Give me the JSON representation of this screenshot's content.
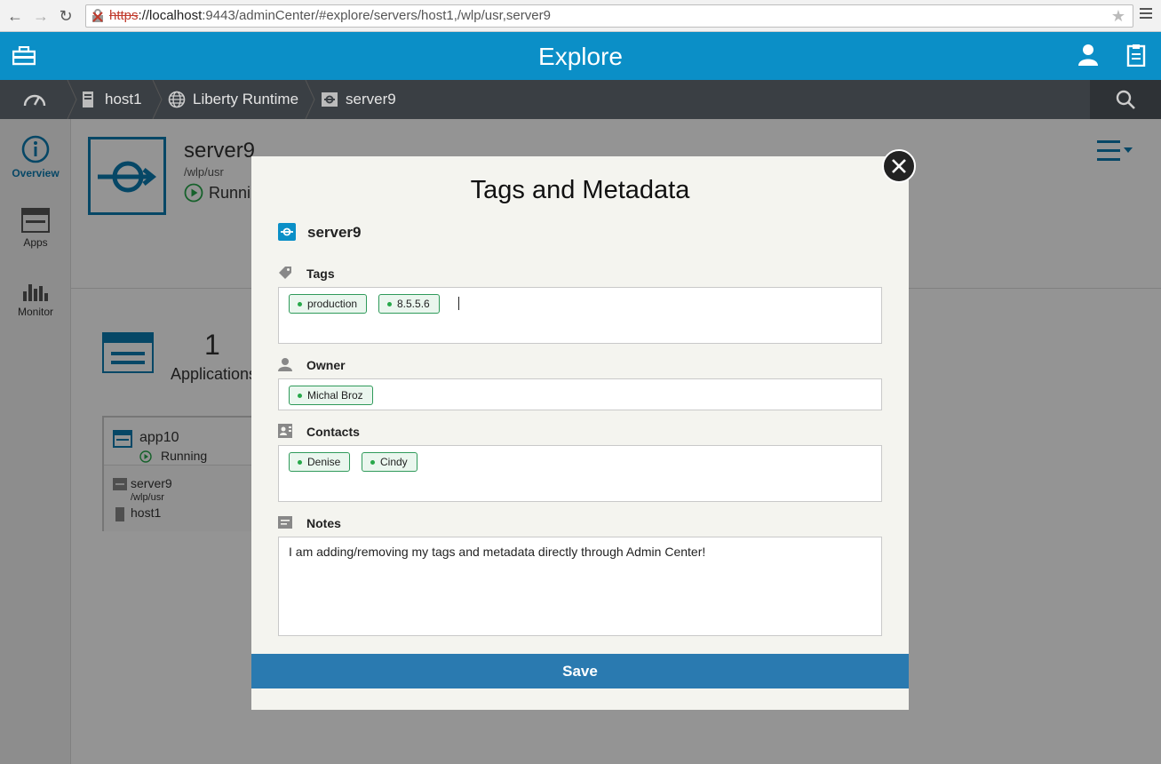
{
  "browser": {
    "url_scheme": "https",
    "url_host": "://localhost",
    "url_rest": ":9443/adminCenter/#explore/servers/host1,/wlp/usr,server9"
  },
  "header": {
    "title": "Explore"
  },
  "breadcrumb": {
    "items": [
      {
        "label": "host1",
        "icon": "server-icon"
      },
      {
        "label": "Liberty Runtime",
        "icon": "globe-icon"
      },
      {
        "label": "server9",
        "icon": "server-link-icon"
      }
    ]
  },
  "left_nav": {
    "items": [
      {
        "label": "Overview",
        "icon": "info-icon",
        "active": true
      },
      {
        "label": "Apps",
        "icon": "apps-icon",
        "active": false
      },
      {
        "label": "Monitor",
        "icon": "monitor-icon",
        "active": false
      }
    ]
  },
  "server": {
    "name": "server9",
    "path": "/wlp/usr",
    "state": "Runni"
  },
  "apps_summary": {
    "count": "1",
    "label": "Applications"
  },
  "app_card": {
    "name": "app10",
    "state": "Running",
    "server": "server9",
    "path": "/wlp/usr",
    "host": "host1"
  },
  "modal": {
    "title": "Tags and Metadata",
    "server_name": "server9",
    "tags_label": "Tags",
    "tags": [
      "production",
      "8.5.5.6"
    ],
    "owner_label": "Owner",
    "owner": [
      "Michal Broz"
    ],
    "contacts_label": "Contacts",
    "contacts": [
      "Denise",
      "Cindy"
    ],
    "notes_label": "Notes",
    "notes": "I am adding/removing my tags and metadata directly through Admin Center!",
    "save_label": "Save"
  },
  "colors": {
    "brand": "#0b8fc7",
    "dark_bar": "#3a3f44",
    "save": "#2a7ab0",
    "tag_border": "#2f9a5a",
    "tag_dot": "#27a84a"
  }
}
